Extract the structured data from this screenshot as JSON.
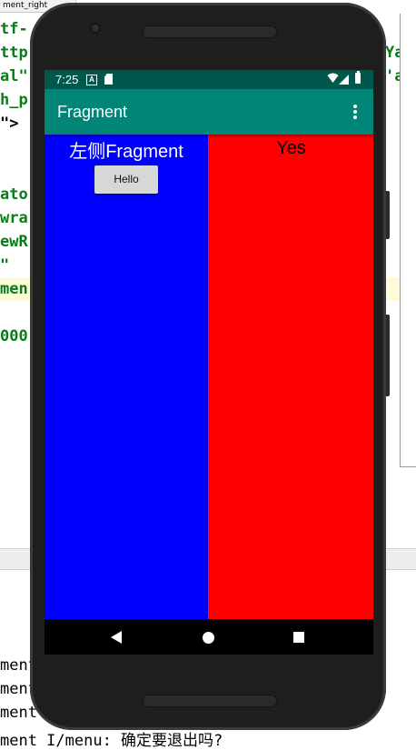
{
  "ide": {
    "tab_label": "ment_right",
    "right_label": "",
    "code_lines": [
      "tf-",
      "ttp",
      "al\"",
      "h_p",
      "\">",
      "ato",
      "wra",
      "ewR",
      "\"",
      "men",
      "000"
    ],
    "right_code_lines": [
      "Ya",
      "'a"
    ],
    "log_lines": [
      "ment",
      "ment",
      "ment",
      "ment I/menu: 确定要退出吗?"
    ]
  },
  "statusbar": {
    "time": "7:25",
    "a_icon": "A",
    "icons": [
      "a-notification-icon",
      "sd-card-icon",
      "wifi-icon",
      "signal-icon",
      "battery-icon"
    ]
  },
  "appbar": {
    "title": "Fragment",
    "overflow_icon": "more-vert-icon"
  },
  "left_fragment": {
    "title": "左侧Fragment",
    "button_label": "Hello",
    "color": "#0000ff"
  },
  "right_fragment": {
    "title": "Yes",
    "color": "#ff0000"
  },
  "navbar": {
    "icons": [
      "back-icon",
      "home-icon",
      "recents-icon"
    ]
  },
  "colors": {
    "status_bar": "#00574b",
    "app_bar": "#008577"
  }
}
